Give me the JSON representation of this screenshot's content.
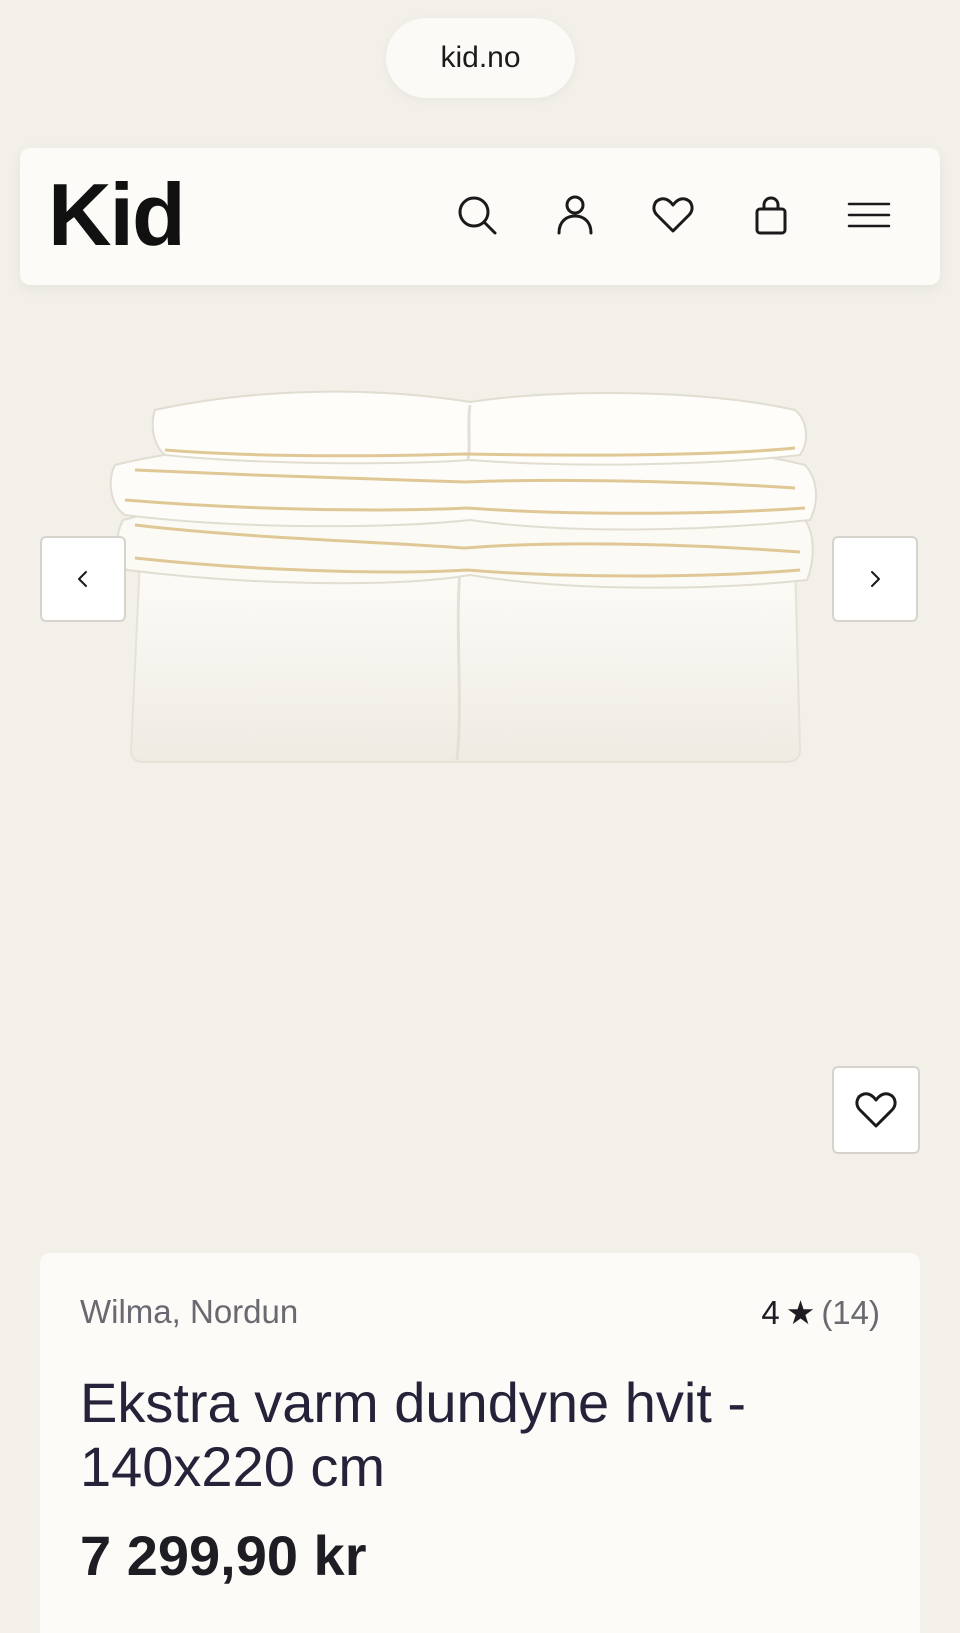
{
  "browser": {
    "url": "kid.no"
  },
  "header": {
    "logo": "Kid",
    "icons": [
      "search-icon",
      "user-icon",
      "heart-icon",
      "bag-icon",
      "menu-icon"
    ]
  },
  "gallery": {
    "image_alt": "Ekstra varm dundyne hvit",
    "prev_icon": "chevron-left-icon",
    "next_icon": "chevron-right-icon",
    "wishlist_icon": "heart-icon"
  },
  "product": {
    "brand": "Wilma, Nordun",
    "rating_value": "4",
    "rating_star": "★",
    "rating_count": "(14)",
    "title": "Ekstra varm dundyne hvit - 140x220 cm",
    "price": "7 299,90 kr"
  }
}
